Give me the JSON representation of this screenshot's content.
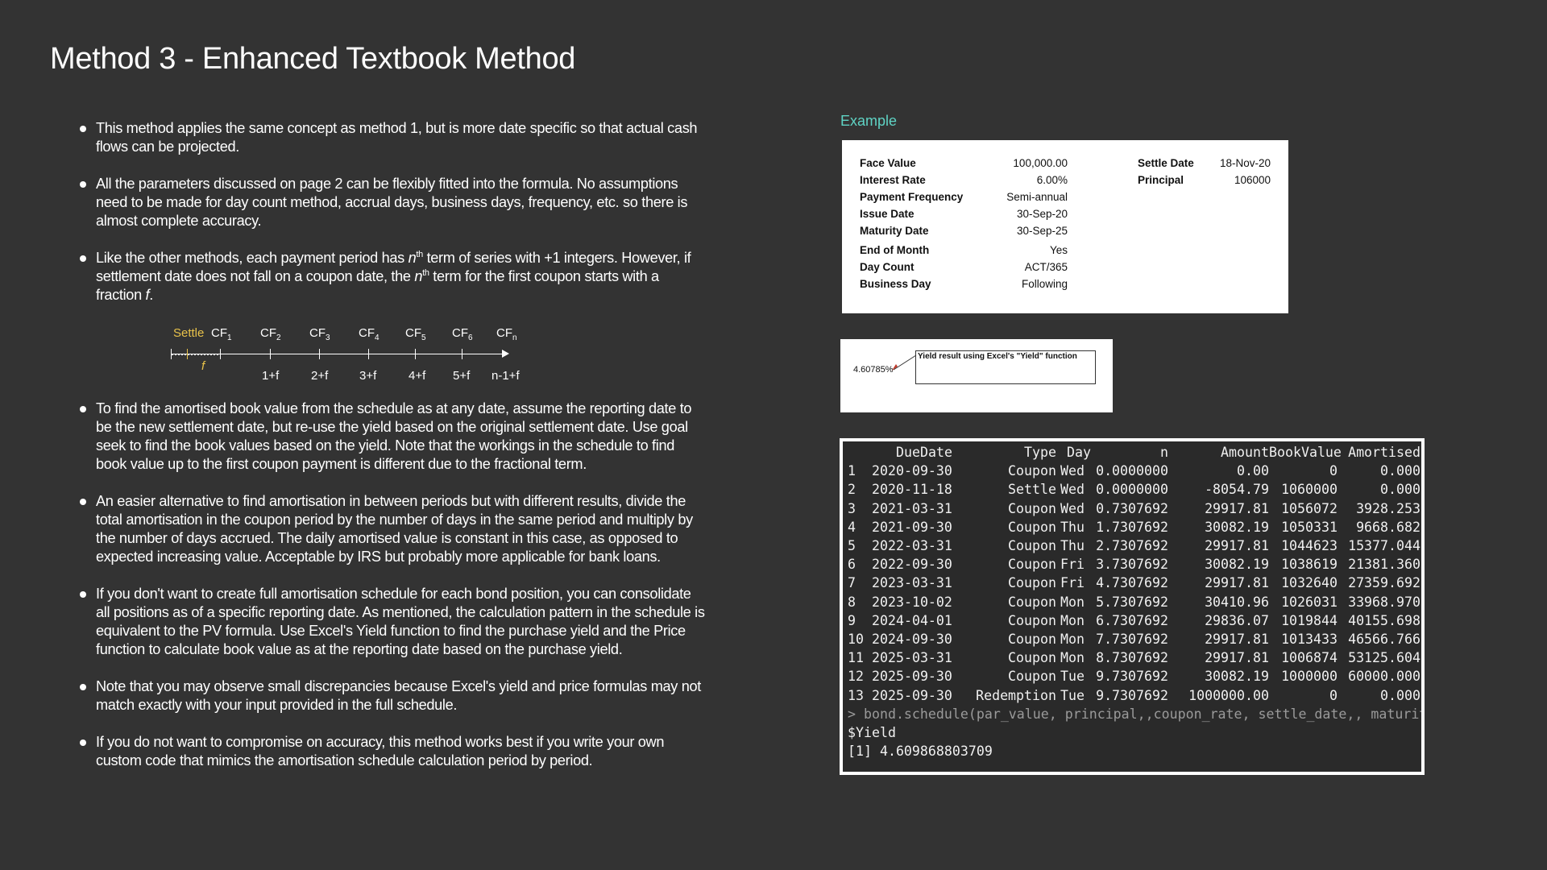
{
  "title": "Method 3 - Enhanced Textbook Method",
  "bullets": {
    "b1": "This method applies the same concept as method 1, but is more date specific so that actual cash flows can be projected.",
    "b2": "All the parameters discussed on page 2 can be flexibly fitted into the formula. No assumptions need to be made for day count method, accrual days, business days, frequency, etc. so there is almost complete accuracy.",
    "b3_part1": "Like the other methods, each payment period has ",
    "b3_n1": "n",
    "b3_th1": "th",
    "b3_part2": " term of series with +1 integers. However, if settlement date does not fall on a coupon date, the ",
    "b3_n2": "n",
    "b3_th2": "th",
    "b3_part3": " term for the first coupon starts with a fraction ",
    "b3_f": "f",
    "b3_end": ".",
    "b4": "To find the amortised book value from the schedule as at any date, assume the reporting date to be the new settlement date, but re-use the yield based on the original settlement date. Use goal seek to find the book values based on the yield. Note that the workings in the schedule to find book value up to the first coupon payment is different due to the fractional term.",
    "b5": "An easier alternative to find amortisation in between periods but with different results, divide the total amortisation in the coupon period by the number of days in the same period and multiply by the number of days accrued. The daily amortised value is constant in this case, as opposed to expected increasing value. Acceptable by IRS but probably more applicable for bank loans.",
    "b6": "If you don't want to create full amortisation schedule for each bond position, you can consolidate all positions as of a specific reporting date. As mentioned, the calculation pattern in the schedule is equivalent to the PV formula. Use Excel's Yield function to find the purchase yield and the Price function to calculate book value as at the reporting date based on the purchase yield.",
    "b7": "Note that you may observe small discrepancies because Excel's yield and price formulas may not match exactly with your input provided in the full schedule.",
    "b8": "If you do not want to compromise on accuracy, this method works best if you write your own custom code that mimics the amortisation schedule calculation period by period."
  },
  "timeline": {
    "settle": "Settle",
    "f": "f",
    "cf": "CF",
    "cf_subs": [
      "1",
      "2",
      "3",
      "4",
      "5",
      "6",
      "n"
    ],
    "bottom": [
      "1+f",
      "2+f",
      "3+f",
      "4+f",
      "5+f",
      "n-1+f"
    ]
  },
  "example": {
    "heading": "Example",
    "params_left": [
      {
        "label": "Face Value",
        "value": "100,000.00"
      },
      {
        "label": "Interest Rate",
        "value": "6.00%"
      },
      {
        "label": "Payment Frequency",
        "value": "Semi-annual"
      },
      {
        "label": "Issue Date",
        "value": "30-Sep-20"
      },
      {
        "label": "Maturity Date",
        "value": "30-Sep-25"
      },
      {
        "label": "End of Month",
        "value": "Yes"
      },
      {
        "label": "Day Count",
        "value": "ACT/365"
      },
      {
        "label": "Business Day",
        "value": "Following"
      }
    ],
    "params_right": [
      {
        "label": "Settle Date",
        "value": "18-Nov-20"
      },
      {
        "label": "Principal",
        "value": "106000"
      }
    ],
    "yield_value": "4.60785%",
    "yield_caption": "Yield result using Excel's \"Yield\" function"
  },
  "console": {
    "headers": [
      "DueDate",
      "Type",
      "Day",
      "n",
      "Amount",
      "BookValue",
      "Amortised"
    ],
    "rows": [
      [
        "1",
        "2020-09-30",
        "Coupon",
        "Wed",
        "0.0000000",
        "0.00",
        "0",
        "0.000"
      ],
      [
        "2",
        "2020-11-18",
        "Settle",
        "Wed",
        "0.0000000",
        "-8054.79",
        "1060000",
        "0.000"
      ],
      [
        "3",
        "2021-03-31",
        "Coupon",
        "Wed",
        "0.7307692",
        "29917.81",
        "1056072",
        "3928.253"
      ],
      [
        "4",
        "2021-09-30",
        "Coupon",
        "Thu",
        "1.7307692",
        "30082.19",
        "1050331",
        "9668.682"
      ],
      [
        "5",
        "2022-03-31",
        "Coupon",
        "Thu",
        "2.7307692",
        "29917.81",
        "1044623",
        "15377.044"
      ],
      [
        "6",
        "2022-09-30",
        "Coupon",
        "Fri",
        "3.7307692",
        "30082.19",
        "1038619",
        "21381.360"
      ],
      [
        "7",
        "2023-03-31",
        "Coupon",
        "Fri",
        "4.7307692",
        "29917.81",
        "1032640",
        "27359.692"
      ],
      [
        "8",
        "2023-10-02",
        "Coupon",
        "Mon",
        "5.7307692",
        "30410.96",
        "1026031",
        "33968.970"
      ],
      [
        "9",
        "2024-04-01",
        "Coupon",
        "Mon",
        "6.7307692",
        "29836.07",
        "1019844",
        "40155.698"
      ],
      [
        "10",
        "2024-09-30",
        "Coupon",
        "Mon",
        "7.7307692",
        "29917.81",
        "1013433",
        "46566.766"
      ],
      [
        "11",
        "2025-03-31",
        "Coupon",
        "Mon",
        "8.7307692",
        "29917.81",
        "1006874",
        "53125.604"
      ],
      [
        "12",
        "2025-09-30",
        "Coupon",
        "Tue",
        "9.7307692",
        "30082.19",
        "1000000",
        "60000.000"
      ],
      [
        "13",
        "2025-09-30",
        "Redemption",
        "Tue",
        "9.7307692",
        "1000000.00",
        "0",
        "0.000"
      ]
    ],
    "command": "> bond.schedule(par_value, principal,,coupon_rate, settle_date,, maturity",
    "yield_label": "$Yield",
    "yield_output": "[1] 4.609868803709"
  }
}
